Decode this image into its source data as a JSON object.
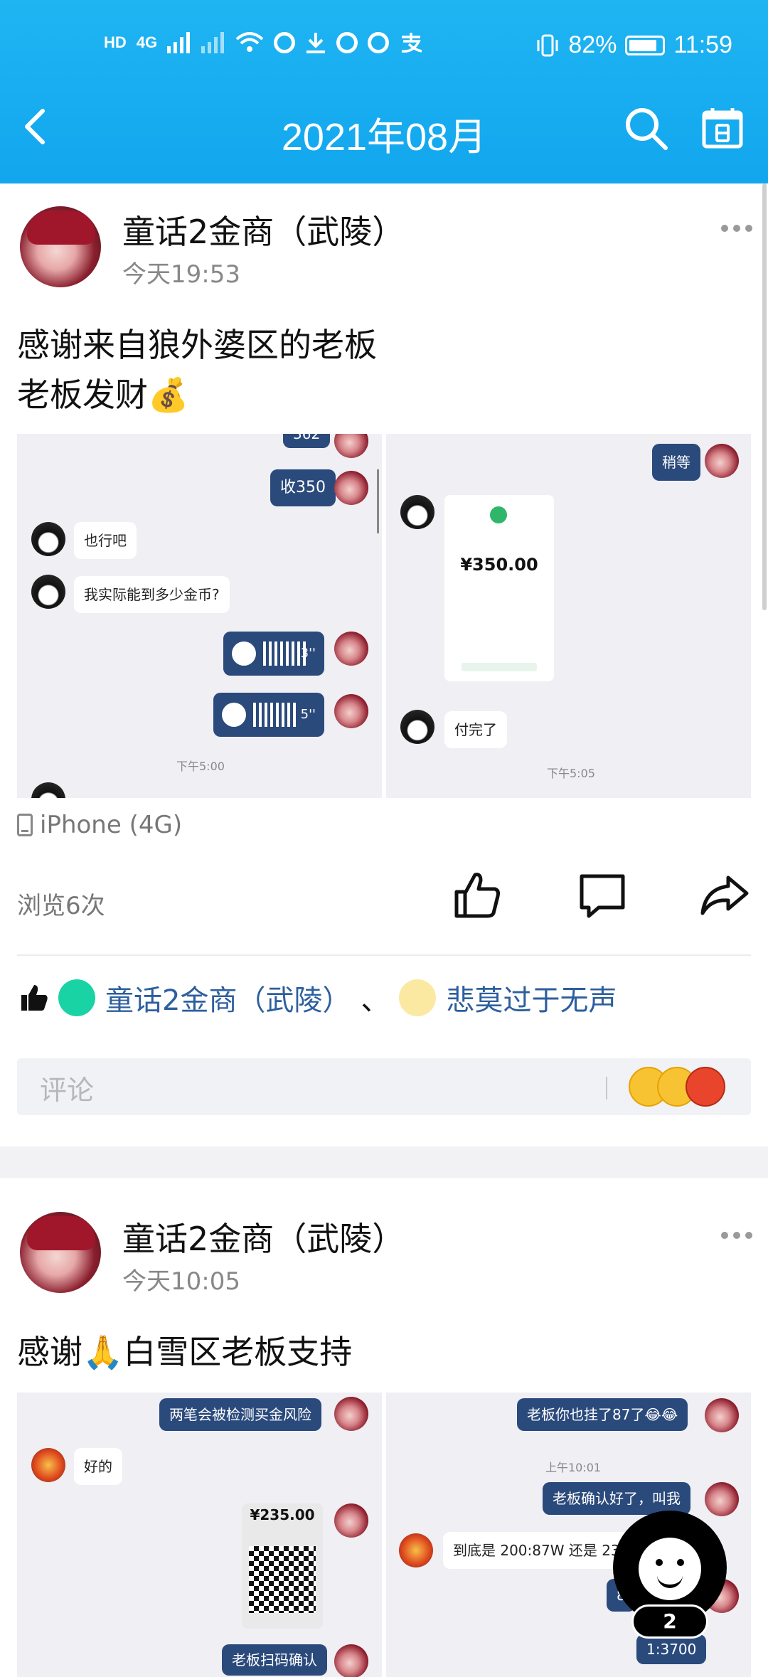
{
  "status_bar": {
    "hd_label": "HD",
    "net_label": "4G",
    "battery_percent": "82%",
    "time": "11:59"
  },
  "header": {
    "title": "2021年08月"
  },
  "posts": [
    {
      "user": "童话2金商（武陵）",
      "time": "今天19:53",
      "text_lines": [
        "感谢来自狼外婆区的老板",
        "老板发财💰"
      ],
      "left_shot": {
        "bubble_top": "362",
        "bubble_out_1": "收350",
        "bubble_in_1": "也行吧",
        "bubble_in_2": "我实际能到多少金币?",
        "voice_1": "3''",
        "voice_2": "5''",
        "timestamp": "下午5:00"
      },
      "right_shot": {
        "bubble_out_1": "稍等",
        "amount": "¥350.00",
        "bubble_in_1": "付完了",
        "timestamp": "下午5:05"
      },
      "device": "iPhone (4G)",
      "views": "浏览6次",
      "likers": [
        "童话2金商（武陵）",
        "悲莫过于无声"
      ],
      "likers_sep": "、",
      "comment_placeholder": "评论"
    },
    {
      "user": "童话2金商（武陵）",
      "time": "今天10:05",
      "text_lines": [
        "感谢🙏白雪区老板支持"
      ],
      "left_shot": {
        "bubble_out_1": "两笔会被检测买金风险",
        "bubble_in_1": "好的",
        "amount": "¥235.00",
        "bubble_out_2": "老板扫码确认"
      },
      "right_shot": {
        "bubble_out_1": "老板你也挂了87了😂😂",
        "timestamp": "上午10:01",
        "bubble_out_2": "老板确认好了，叫我",
        "bubble_in_1": "到底是 200:87W 还是 23",
        "bubble_out_3": "8",
        "bubble_out_4": "1:3700"
      }
    }
  ],
  "floating_button": {
    "badge": "2"
  },
  "colors": {
    "header_bg": "#12a6ee",
    "link_blue": "#2d5f9e",
    "bubble_out": "#2b4a7c"
  }
}
